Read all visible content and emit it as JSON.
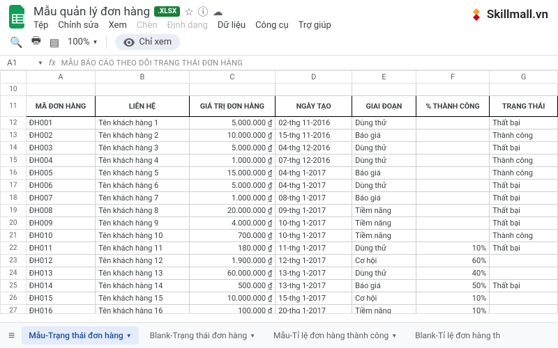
{
  "doc": {
    "title": "Mẫu quản lý đơn hàng",
    "badge": ".XLSX"
  },
  "menu": {
    "file": "Tệp",
    "edit": "Chỉnh sửa",
    "view": "Xem",
    "insert": "Chèn",
    "format": "Định dạng",
    "data": "Dữ liệu",
    "tools": "Công cụ",
    "help": "Trợ giúp"
  },
  "toolbar": {
    "zoom": "100%",
    "viewonly": "Chỉ xem"
  },
  "brand": "Skillmall.vn",
  "formula": {
    "cell": "A1",
    "text": "MẪU BÁO CÁO THEO DÕI TRẠNG THÁI ĐƠN HÀNG"
  },
  "cols": [
    "",
    "A",
    "B",
    "C",
    "D",
    "E",
    "F",
    "G"
  ],
  "head": {
    "row": "11",
    "id": "MÃ ĐƠN HÀNG",
    "contact": "LIÊN HỆ",
    "value": "GIÁ TRỊ ĐƠN HÀNG",
    "date": "NGÀY TẠO",
    "stage": "GIAI ĐOẠN",
    "pct": "% THÀNH CÔNG",
    "status": "TRẠNG THÁI"
  },
  "rows": [
    {
      "n": "12",
      "id": "ĐH001",
      "c": "Tên khách hàng 1",
      "v": "5.000.000 ₫",
      "d": "02-thg 11-2016",
      "s": "Dùng thử",
      "p": "",
      "t": "Thất bại"
    },
    {
      "n": "13",
      "id": "ĐH002",
      "c": "Tên khách hàng 2",
      "v": "10.000.000 ₫",
      "d": "15-thg 11-2016",
      "s": "Báo giá",
      "p": "",
      "t": "Thành công"
    },
    {
      "n": "14",
      "id": "ĐH003",
      "c": "Tên khách hàng 3",
      "v": "5.000.000 ₫",
      "d": "04-thg 12-2016",
      "s": "Dùng thử",
      "p": "",
      "t": "Thất bại"
    },
    {
      "n": "15",
      "id": "ĐH004",
      "c": "Tên khách hàng 4",
      "v": "1.000.000 ₫",
      "d": "07-thg 12-2016",
      "s": "Dùng thử",
      "p": "",
      "t": "Thành công"
    },
    {
      "n": "16",
      "id": "ĐH005",
      "c": "Tên khách hàng 5",
      "v": "15.000.000 ₫",
      "d": "04-thg 1-2017",
      "s": "Báo giá",
      "p": "",
      "t": "Thành công"
    },
    {
      "n": "17",
      "id": "ĐH006",
      "c": "Tên khách hàng 6",
      "v": "5.000.000 ₫",
      "d": "04-thg 1-2017",
      "s": "Dùng thử",
      "p": "",
      "t": "Thất bại"
    },
    {
      "n": "18",
      "id": "ĐH007",
      "c": "Tên khách hàng 7",
      "v": "1.000.000 ₫",
      "d": "08-thg 1-2017",
      "s": "Báo giá",
      "p": "",
      "t": "Thất bại"
    },
    {
      "n": "19",
      "id": "ĐH008",
      "c": "Tên khách hàng 8",
      "v": "20.000.000 ₫",
      "d": "09-thg 1-2017",
      "s": "Tiềm năng",
      "p": "",
      "t": "Thất bại"
    },
    {
      "n": "20",
      "id": "ĐH009",
      "c": "Tên khách hàng 9",
      "v": "4.000.000 ₫",
      "d": "10-thg 1-2017",
      "s": "Tiềm năng",
      "p": "",
      "t": "Thất bại"
    },
    {
      "n": "21",
      "id": "ĐH010",
      "c": "Tên khách hàng 10",
      "v": "700.000 ₫",
      "d": "10-thg 1-2017",
      "s": "Tiềm năng",
      "p": "",
      "t": "Thành công"
    },
    {
      "n": "22",
      "id": "ĐH011",
      "c": "Tên khách hàng 11",
      "v": "180.000 ₫",
      "d": "11-thg 1-2017",
      "s": "Dùng thử",
      "p": "10%",
      "t": "Thất bại"
    },
    {
      "n": "23",
      "id": "ĐH012",
      "c": "Tên khách hàng 12",
      "v": "1.900.000 ₫",
      "d": "12-thg 1-2017",
      "s": "Cơ hội",
      "p": "60%",
      "t": ""
    },
    {
      "n": "24",
      "id": "ĐH013",
      "c": "Tên khách hàng 13",
      "v": "60.000.000 ₫",
      "d": "13-thg 1-2017",
      "s": "Dùng thử",
      "p": "40%",
      "t": ""
    },
    {
      "n": "25",
      "id": "ĐH014",
      "c": "Tên khách hàng 14",
      "v": "500.000 ₫",
      "d": "13-thg 1-2017",
      "s": "Báo giá",
      "p": "50%",
      "t": "Thất bại"
    },
    {
      "n": "26",
      "id": "ĐH015",
      "c": "Tên khách hàng 15",
      "v": "10.000.000 ₫",
      "d": "15-thg 1-2017",
      "s": "Cơ hội",
      "p": "10%",
      "t": ""
    },
    {
      "n": "27",
      "id": "ĐH016",
      "c": "Tên khách hàng 16",
      "v": "100.000 ₫",
      "d": "20-thg 1-2017",
      "s": "Tiềm năng",
      "p": "10%",
      "t": ""
    }
  ],
  "tabs": {
    "t1": "Mẫu-Trạng thái đơn hàng",
    "t2": "Blank-Trạng thái đơn hàng",
    "t3": "Mẫu-Tỉ lệ đơn hàng thành công",
    "t4": "Blank-Tỉ lệ đơn hàng th"
  }
}
